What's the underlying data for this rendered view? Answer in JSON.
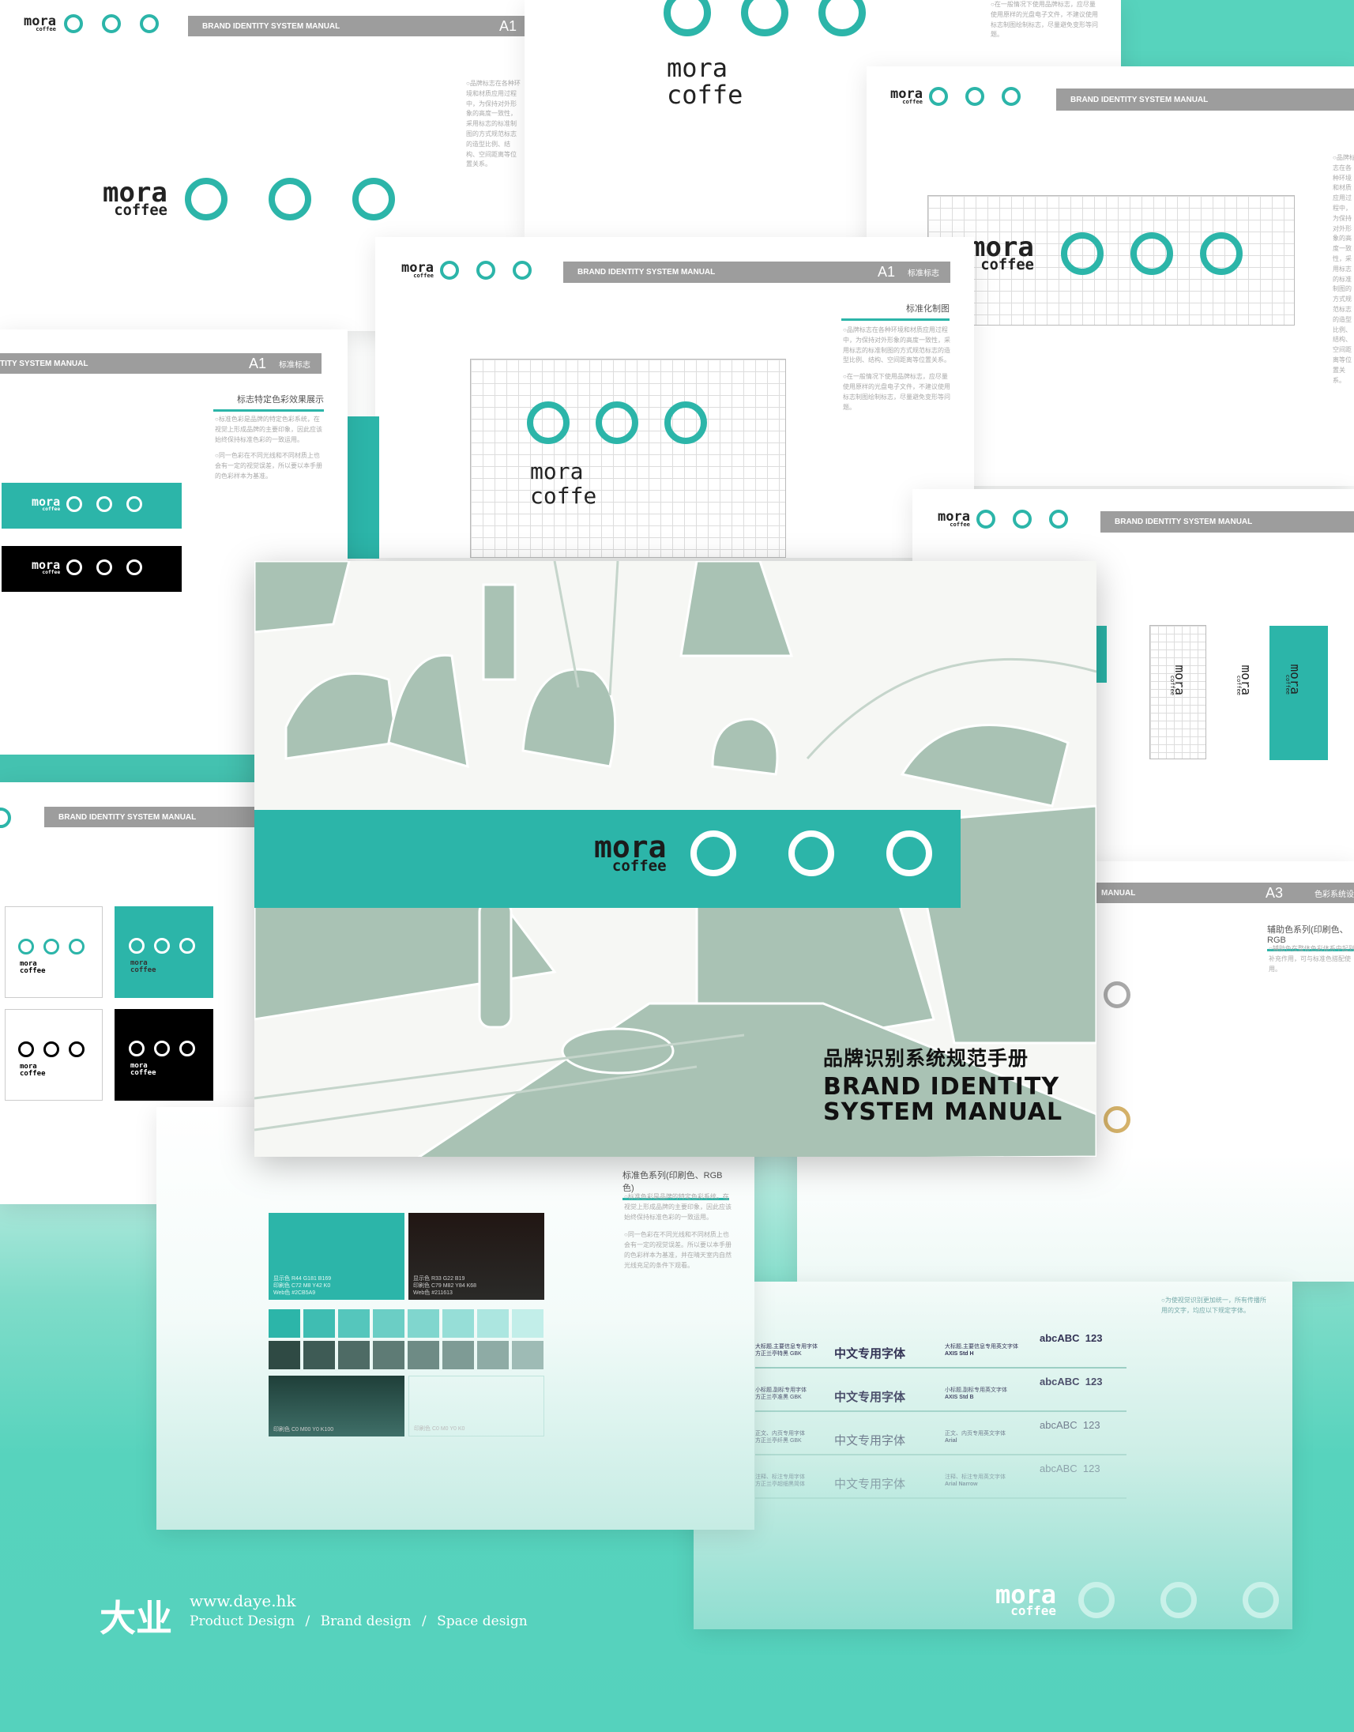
{
  "brand": {
    "word": "mora",
    "sub": "coffee",
    "sub_short": "coffe"
  },
  "colors": {
    "teal": "#2CB5A9",
    "dark": "#211613",
    "gold": "#D6B36A",
    "gray": "#AAAAAA",
    "bg_teal": "#55D2BD"
  },
  "manual": {
    "bar_label": "BRAND IDENTITY SYSTEM MANUAL",
    "bar_label_cut": "TITY SYSTEM MANUAL",
    "bar_label_cut2": "MANUAL",
    "code_a1": "A1",
    "code_a3": "A3",
    "sec_logo": "标准标志",
    "sec_color": "色彩系统设"
  },
  "pages": {
    "grid": {
      "heading": "标准化制图",
      "para1": "○品牌标志在各种环境和材质应用过程中，为保持对外形象的高度一致性，采用标志的标准制图的方式规范标志的造型比例、结构、空间距离等位置关系。",
      "para2": "○在一般情况下使用品牌标志，应尽量使用原样的光盘电子文件，不建议使用标志制图绘制标志，尽量避免变形等问题。"
    },
    "color_effect": {
      "heading": "标志特定色彩效果展示",
      "para1": "○标准色彩是品牌的特定色彩系统，在视觉上形成品牌的主要印象，因此应该始终保持标准色彩的一致运用。",
      "para2": "○同一色彩在不同光线和不同材质上也会有一定的视觉误差，所以要以本手册的色彩样本为基准。"
    },
    "aux": {
      "heading": "辅助色系列(印刷色、RGB",
      "para": "○辅助色在整体色彩体系中起到补充作用，可与标准色搭配使用。"
    },
    "std_color": {
      "heading": "标准色系列(印刷色、RGB色)",
      "para1": "○标准色彩是品牌的特定色彩系统。在视觉上形成品牌的主要印象，因此应该始终保持标准色彩的一致运用。",
      "para2": "○同一色彩在不同光线和不同材质上也会有一定的视觉误差。所以要以本手册的色彩样本为基准，并在晴天室内自然光线充足的条件下观看。",
      "teal_spec": [
        "显示色 R44 G181 B169",
        "印刷色 C72 M8 Y42 K0",
        "Web色 #2CB5A9"
      ],
      "dark_spec": [
        "显示色 R33 G22 B19",
        "印刷色 C79 M82 Y84 K68",
        "Web色 #211613"
      ],
      "black_spec": "印刷色 C0 M00 Y0 K100",
      "white_spec": "印刷色 C0 M0 Y0 K0"
    },
    "fonts": {
      "rows": [
        {
          "cn_desc": "大标题,主要信息专用字体",
          "cn_font": "方正兰亭特黑 GBK",
          "sample": "中文专用字体",
          "en_desc": "大标题,主要信息专用英文字体",
          "en_font": "AXIS Std H",
          "abc": "abcABC  123"
        },
        {
          "cn_desc": "小标题,副标专用字体",
          "cn_font": "方正兰亭准黑 GBK",
          "sample": "中文专用字体",
          "en_desc": "小标题,副标专用英文字体",
          "en_font": "AXIS Std B",
          "abc": "abcABC  123"
        },
        {
          "cn_desc": "正文、内页专用字体",
          "cn_font": "方正兰亭纤黑 GBK",
          "sample": "中文专用字体",
          "en_desc": "正文、内页专用英文字体",
          "en_font": "Arial",
          "abc": "abcABC  123"
        },
        {
          "cn_desc": "注释、标注专用字体",
          "cn_font": "方正兰亭超细黑简体",
          "sample": "中文专用字体",
          "en_desc": "注释、标注专用英文字体",
          "en_font": "Arial Narrow",
          "abc": "abcABC  123"
        }
      ],
      "para": "○为使视觉识别更加统一，所有传播所用的文字，均应以下规定字体。"
    }
  },
  "cover": {
    "title_cn": "品牌识别系统规范手册",
    "title_en_1": "BRAND IDENTITY",
    "title_en_2": "SYSTEM MANUAL"
  },
  "footer": {
    "logo": "大业",
    "url": "www.daye.hk",
    "services": [
      "Product Design",
      "Brand design",
      "Space design"
    ],
    "sep": "/"
  }
}
